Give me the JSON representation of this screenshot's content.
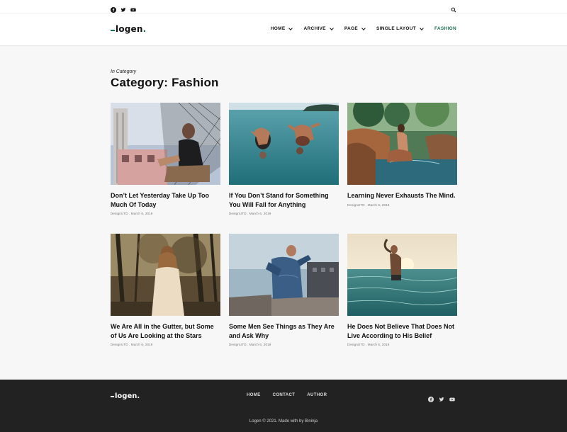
{
  "topbar": {
    "socials": [
      "facebook-icon",
      "twitter-icon",
      "youtube-icon"
    ],
    "search_icon": "search-icon"
  },
  "header": {
    "logo_text": "logen",
    "nav": [
      {
        "label": "HOME",
        "has_dropdown": true
      },
      {
        "label": "ARCHIVE",
        "has_dropdown": true
      },
      {
        "label": "PAGE",
        "has_dropdown": true
      },
      {
        "label": "SINGLE LAYOUT",
        "has_dropdown": true
      },
      {
        "label": "FASHION",
        "has_dropdown": false,
        "active": true
      }
    ]
  },
  "page": {
    "kicker": "In Category",
    "title": "Category: Fashion"
  },
  "posts": [
    {
      "title": "Don’t Let Yesterday Take Up Too Much Of Today",
      "author": "DesignUTD",
      "date": "March 6, 2019"
    },
    {
      "title": "If You Don’t Stand for Something You Will Fall for Anything",
      "author": "DesignUTD",
      "date": "March 6, 2019"
    },
    {
      "title": "Learning Never Exhausts The Mind.",
      "author": "DesignUTD",
      "date": "March 6, 2019"
    },
    {
      "title": "We Are All in the Gutter, but Some of Us Are Looking at the Stars",
      "author": "DesignUTD",
      "date": "March 6, 2019"
    },
    {
      "title": "Some Men See Things as They Are and Ask Why",
      "author": "DesignUTD",
      "date": "March 6, 2019"
    },
    {
      "title": "He Does Not Believe That Does Not Live According to His Belief",
      "author": "DesignUTD",
      "date": "March 6, 2019"
    }
  ],
  "footer": {
    "logo_text": "logen",
    "nav": [
      "HOME",
      "CONTACT",
      "AUTHOR"
    ],
    "socials": [
      "facebook-icon",
      "twitter-icon",
      "youtube-icon"
    ],
    "copyright": "Logen © 2021. Made with by Bininja"
  },
  "colors": {
    "accent": "#1a6f4f",
    "footer_bg": "#222222",
    "page_bg": "#f7f7f7"
  }
}
